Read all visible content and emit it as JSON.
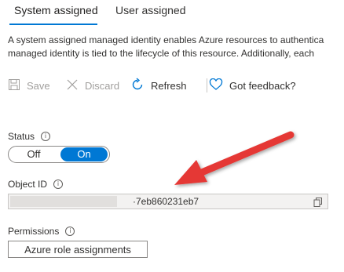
{
  "tabs": [
    {
      "label": "System assigned",
      "active": true
    },
    {
      "label": "User assigned",
      "active": false
    }
  ],
  "description": {
    "line1": "A system assigned managed identity enables Azure resources to authentica",
    "line2": "managed identity is tied to the lifecycle of this resource. Additionally, each"
  },
  "toolbar": {
    "save_label": "Save",
    "discard_label": "Discard",
    "refresh_label": "Refresh",
    "feedback_label": "Got feedback?"
  },
  "status": {
    "label": "Status",
    "off_label": "Off",
    "on_label": "On",
    "value": "On"
  },
  "object_id": {
    "label": "Object ID",
    "value_visible": "·7eb860231eb7"
  },
  "permissions": {
    "label": "Permissions",
    "button_label": "Azure role assignments"
  },
  "colors": {
    "accent": "#0078d4",
    "annotation_arrow": "#e53935"
  },
  "icons": [
    "save-icon",
    "discard-icon",
    "refresh-icon",
    "heart-icon",
    "info-icon",
    "copy-icon",
    "annotation-arrow"
  ]
}
